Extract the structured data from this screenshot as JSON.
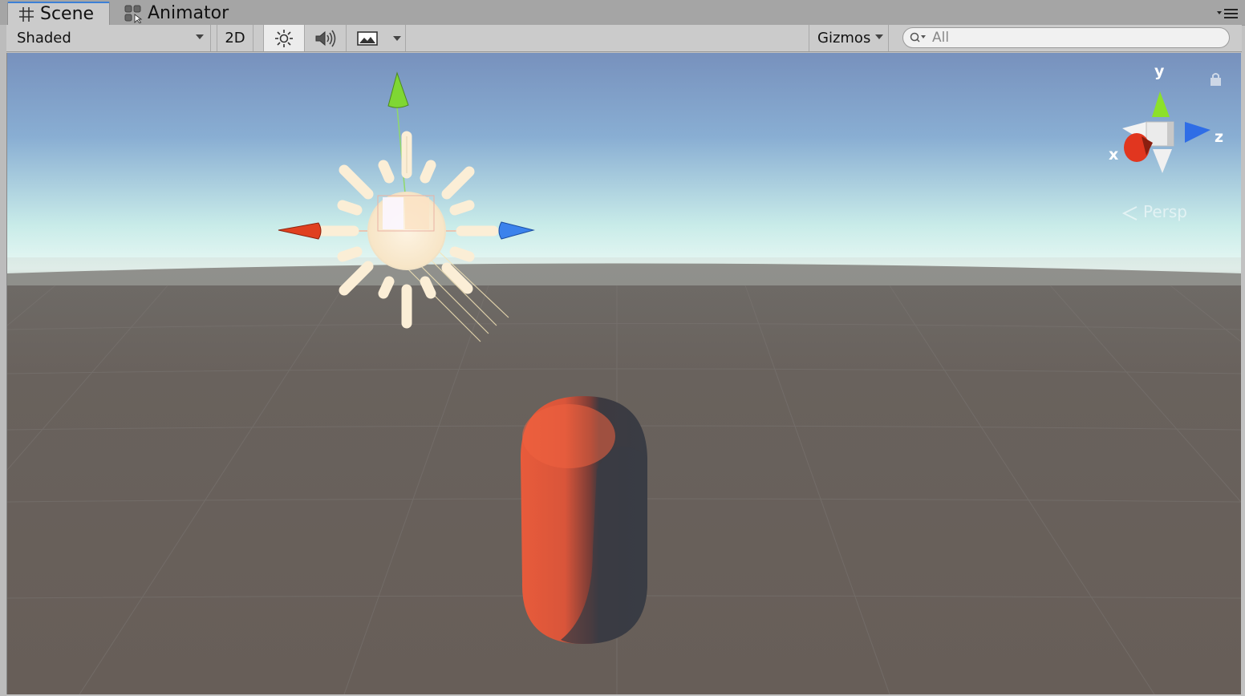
{
  "tabs": [
    {
      "label": "Scene",
      "icon": "hash-icon",
      "active": true
    },
    {
      "label": "Animator",
      "icon": "animator-icon",
      "active": false
    }
  ],
  "toolbar": {
    "shading_mode": "Shaded",
    "mode_2d_label": "2D",
    "gizmos_label": "Gizmos",
    "search_placeholder": "All"
  },
  "scene_gizmo": {
    "axis_x": "x",
    "axis_y": "y",
    "axis_z": "z",
    "projection_label": "Persp"
  },
  "colors": {
    "sky_top": "#7a97c2",
    "horizon": "#e6f7f5",
    "ground": "#69605b",
    "capsule_lit": "#e65c3e",
    "capsule_shadow": "#3a3c44",
    "axis_x": "#e13c22",
    "axis_y": "#8ee12b",
    "axis_z": "#3c7eeb",
    "light_gizmo": "#fbeed6"
  }
}
